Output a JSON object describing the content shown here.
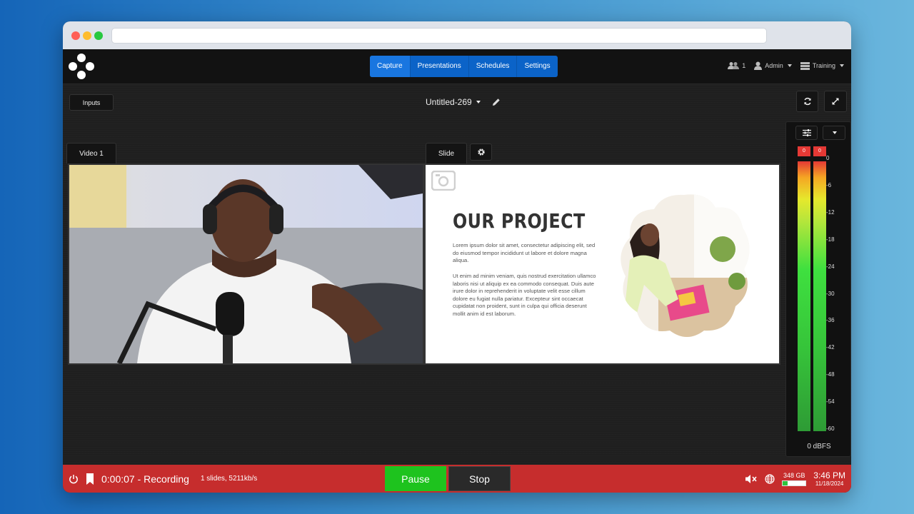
{
  "nav": {
    "items": [
      {
        "label": "Capture",
        "active": true
      },
      {
        "label": "Presentations",
        "active": false
      },
      {
        "label": "Schedules",
        "active": false
      },
      {
        "label": "Settings",
        "active": false
      }
    ]
  },
  "header": {
    "viewer_count": "1",
    "user_label": "Admin",
    "profile_label": "Training"
  },
  "toolbar": {
    "inputs_label": "Inputs",
    "title": "Untitled-269"
  },
  "panels": {
    "video_tab": "Video 1",
    "slide_tab": "Slide"
  },
  "slide": {
    "heading": "OUR PROJECT",
    "paragraph1": "Lorem ipsum dolor sit amet, consectetur adipiscing elit, sed do eiusmod tempor incididunt ut labore et dolore magna aliqua.",
    "paragraph2": "Ut enim ad minim veniam, quis nostrud exercitation ullamco laboris nisi ut aliquip ex ea commodo consequat. Duis aute irure dolor in reprehenderit in voluptate velit esse cillum dolore eu fugiat nulla pariatur. Excepteur sint occaecat cupidatat non proident, sunt in culpa qui officia deserunt mollit anim id est laborum."
  },
  "audio_meter": {
    "peak_left": "0",
    "peak_right": "0",
    "scale": [
      "0",
      "-6",
      "-12",
      "-18",
      "-24",
      "-30",
      "-36",
      "-42",
      "-48",
      "-54",
      "-60"
    ],
    "unit_label": "0 dBFS"
  },
  "status": {
    "elapsed": "0:00:07 - Recording",
    "info": "1 slides, 5211kb/s",
    "pause_label": "Pause",
    "stop_label": "Stop",
    "disk_free": "348 GB",
    "disk_used_fraction": 0.2,
    "time": "3:46 PM",
    "date": "11/18/2024"
  },
  "colors": {
    "nav_blue": "#0b63c8",
    "status_red": "#c62d2d",
    "pause_green": "#1ec31e"
  }
}
